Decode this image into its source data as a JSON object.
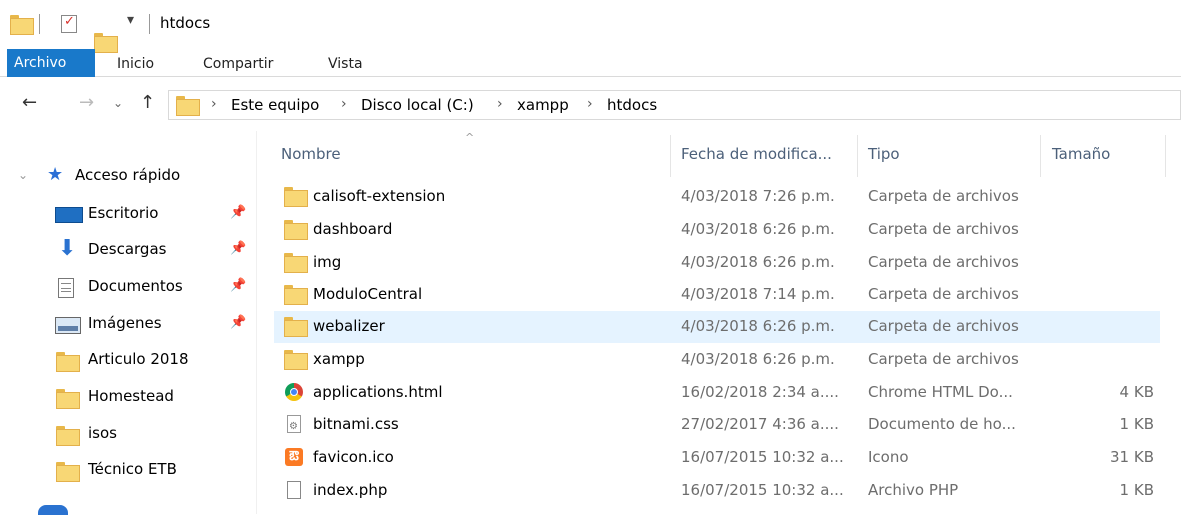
{
  "window": {
    "title": "htdocs"
  },
  "ribbon": {
    "tabs": [
      "Archivo",
      "Inicio",
      "Compartir",
      "Vista"
    ]
  },
  "address": {
    "crumbs": [
      "Este equipo",
      "Disco local (C:)",
      "xampp",
      "htdocs"
    ]
  },
  "sidebar": {
    "section": "Acceso rápido",
    "items": [
      {
        "label": "Escritorio",
        "icon": "desktop-icon",
        "pinned": true
      },
      {
        "label": "Descargas",
        "icon": "download-icon",
        "pinned": true
      },
      {
        "label": "Documentos",
        "icon": "document-icon",
        "pinned": true
      },
      {
        "label": "Imágenes",
        "icon": "image-icon",
        "pinned": true
      },
      {
        "label": "Articulo 2018",
        "icon": "folder-icon",
        "pinned": false
      },
      {
        "label": "Homestead",
        "icon": "folder-icon",
        "pinned": false
      },
      {
        "label": "isos",
        "icon": "folder-icon",
        "pinned": false
      },
      {
        "label": "Técnico ETB",
        "icon": "folder-icon",
        "pinned": false
      }
    ]
  },
  "columns": {
    "name": "Nombre",
    "date": "Fecha de modifica...",
    "type": "Tipo",
    "size": "Tamaño"
  },
  "files": [
    {
      "name": "calisoft-extension",
      "date": "4/03/2018 7:26 p.m.",
      "type": "Carpeta de archivos",
      "size": "",
      "icon": "folder-icon"
    },
    {
      "name": "dashboard",
      "date": "4/03/2018 6:26 p.m.",
      "type": "Carpeta de archivos",
      "size": "",
      "icon": "folder-icon"
    },
    {
      "name": "img",
      "date": "4/03/2018 6:26 p.m.",
      "type": "Carpeta de archivos",
      "size": "",
      "icon": "folder-icon"
    },
    {
      "name": "ModuloCentral",
      "date": "4/03/2018 7:14 p.m.",
      "type": "Carpeta de archivos",
      "size": "",
      "icon": "folder-icon"
    },
    {
      "name": "webalizer",
      "date": "4/03/2018 6:26 p.m.",
      "type": "Carpeta de archivos",
      "size": "",
      "icon": "folder-icon",
      "selected": true
    },
    {
      "name": "xampp",
      "date": "4/03/2018 6:26 p.m.",
      "type": "Carpeta de archivos",
      "size": "",
      "icon": "folder-icon"
    },
    {
      "name": "applications.html",
      "date": "16/02/2018 2:34 a....",
      "type": "Chrome HTML Do...",
      "size": "4 KB",
      "icon": "chrome-icon"
    },
    {
      "name": "bitnami.css",
      "date": "27/02/2017 4:36 a....",
      "type": "Documento de ho...",
      "size": "1 KB",
      "icon": "css-file-icon"
    },
    {
      "name": "favicon.ico",
      "date": "16/07/2015 10:32 a...",
      "type": "Icono",
      "size": "31 KB",
      "icon": "xampp-icon"
    },
    {
      "name": "index.php",
      "date": "16/07/2015 10:32 a...",
      "type": "Archivo PHP",
      "size": "1 KB",
      "icon": "file-icon"
    }
  ],
  "colors": {
    "accent": "#1979ca",
    "selection": "#e5f3ff",
    "folder": "#f8d775"
  }
}
